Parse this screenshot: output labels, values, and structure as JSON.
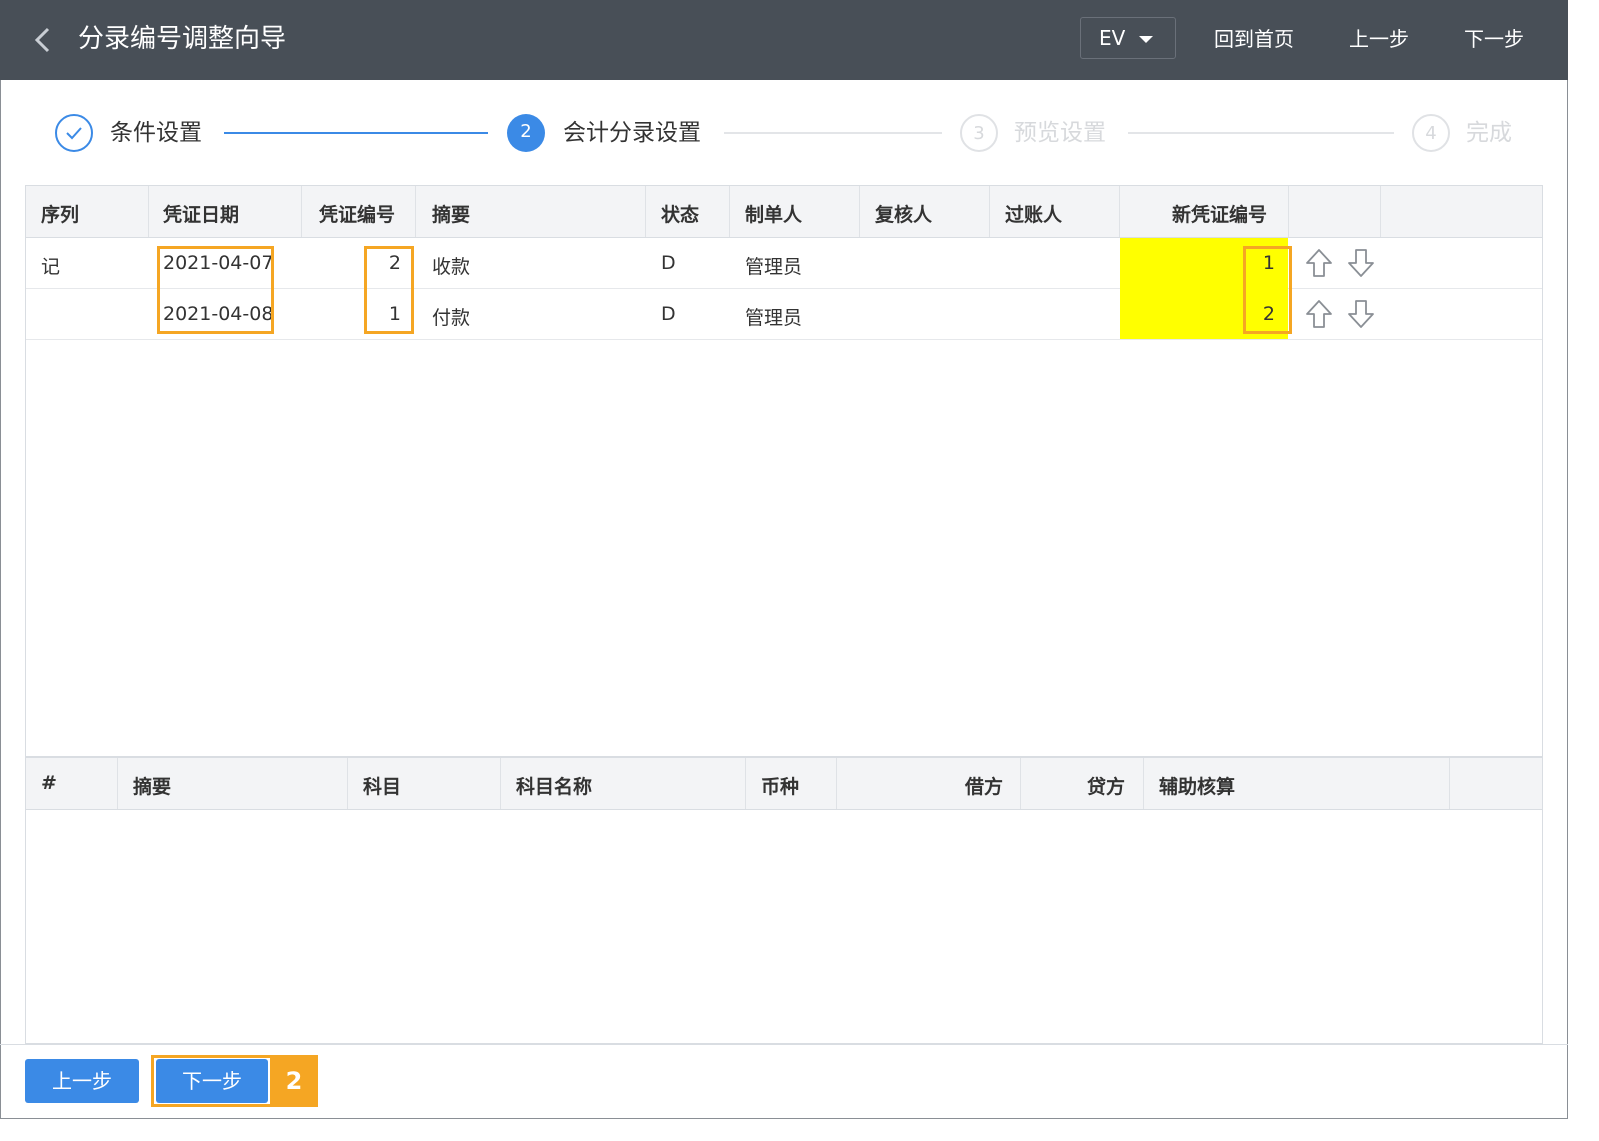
{
  "header": {
    "title": "分录编号调整向导",
    "ev_label": "EV",
    "home_label": "回到首页",
    "prev_label": "上一步",
    "next_label": "下一步"
  },
  "steps": [
    {
      "number": "",
      "label": "条件设置",
      "state": "done"
    },
    {
      "number": "2",
      "label": "会计分录设置",
      "state": "active"
    },
    {
      "number": "3",
      "label": "预览设置",
      "state": "pending"
    },
    {
      "number": "4",
      "label": "完成",
      "state": "pending"
    }
  ],
  "voucher_table": {
    "columns": [
      "序列",
      "凭证日期",
      "凭证编号",
      "摘要",
      "状态",
      "制单人",
      "复核人",
      "过账人",
      "新凭证编号"
    ],
    "rows": [
      {
        "seq": "记",
        "date": "2021-04-07",
        "number": "2",
        "summary": "收款",
        "status": "D",
        "maker": "管理员",
        "reviewer": "",
        "poster": "",
        "new_number": "1"
      },
      {
        "seq": "",
        "date": "2021-04-08",
        "number": "1",
        "summary": "付款",
        "status": "D",
        "maker": "管理员",
        "reviewer": "",
        "poster": "",
        "new_number": "2"
      }
    ]
  },
  "entry_table": {
    "columns": [
      "#",
      "摘要",
      "科目",
      "科目名称",
      "币种",
      "借方",
      "贷方",
      "辅助核算"
    ]
  },
  "footer": {
    "prev_label": "上一步",
    "next_label": "下一步",
    "annotation": "2"
  },
  "colors": {
    "header_bg": "#484f57",
    "accent": "#3b8ae6",
    "highlight": "#f5a623",
    "new_number_bg": "#ffff00"
  }
}
